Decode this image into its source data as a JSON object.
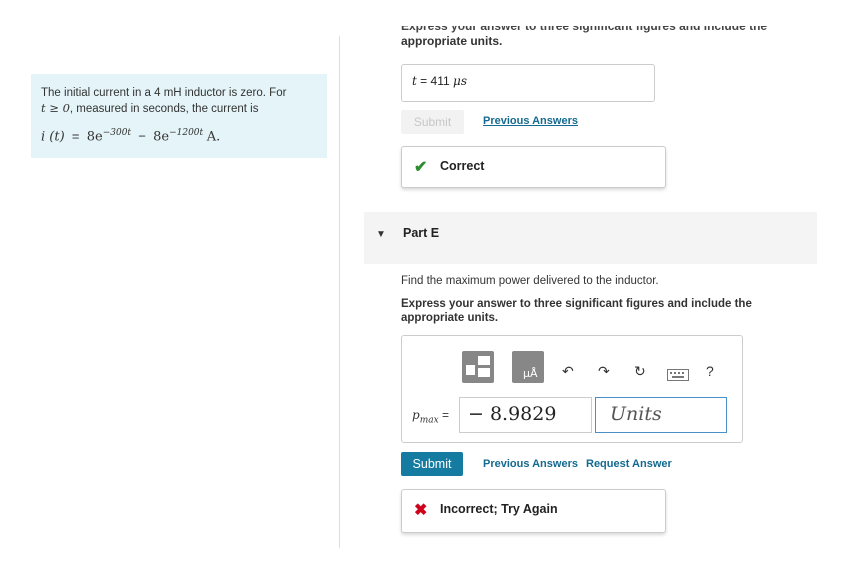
{
  "problem": {
    "intro_text": "The initial current in a 4 mH inductor is zero. For",
    "intro_cond": "t ≥ 0",
    "intro_rest": ", measured in seconds, the current is",
    "eq_lhs": "i (t)",
    "eq_equals": "=",
    "term1_coef": "8e",
    "term1_exp": "−300t",
    "eq_minus": "−",
    "term2_coef": "8e",
    "term2_exp": "−1200t",
    "eq_unit": "A."
  },
  "part_d": {
    "instruction_cut": "Express your answer to three significant figures and include the",
    "instruction_units": "appropriate units.",
    "answer_var": "t",
    "answer_equals": "=",
    "answer_value": "411",
    "answer_unit": "μs",
    "submit_label": "Submit",
    "previous_answers_label": "Previous Answers",
    "feedback_text": "Correct",
    "feedback_icon": "✔"
  },
  "part_e": {
    "toggle_icon": "▼",
    "title": "Part E",
    "question": "Find the maximum power delivered to the inductor.",
    "instruction": "Express your answer to three significant figures and include the appropriate units.",
    "answer_var": "p",
    "answer_var_sub": "max",
    "answer_equals": "=",
    "answer_value": "− 8.9829",
    "units_placeholder": "Units",
    "submit_label": "Submit",
    "previous_answers_label": "Previous Answers",
    "request_answer_label": "Request Answer",
    "feedback_text": "Incorrect; Try Again",
    "feedback_icon": "✖",
    "toolbar": {
      "undo_icon": "↶",
      "redo_icon": "↷",
      "reset_icon": "↻",
      "help_label": "?"
    }
  },
  "colors": {
    "accent": "#157ba0",
    "correct": "#2e8b2e",
    "incorrect": "#d0021b",
    "panel_bg": "#e4f4f8"
  }
}
